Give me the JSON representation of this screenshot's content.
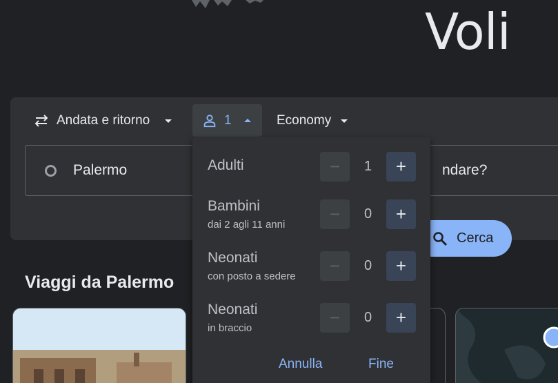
{
  "header": {
    "title": "Voli"
  },
  "search": {
    "trip_type": "Andata e ritorno",
    "passengers_count": "1",
    "cabin_class": "Economy",
    "origin": "Palermo",
    "destination_placeholder_visible": "ndare?",
    "search_label": "Cerca"
  },
  "passengers_panel": {
    "rows": [
      {
        "label": "Adulti",
        "sub": "",
        "value": "1"
      },
      {
        "label": "Bambini",
        "sub": "dai 2 agli 11 anni",
        "value": "0"
      },
      {
        "label": "Neonati",
        "sub": "con posto a sedere",
        "value": "0"
      },
      {
        "label": "Neonati",
        "sub": "in braccio",
        "value": "0"
      }
    ],
    "minus_symbol": "−",
    "plus_symbol": "+",
    "cancel_label": "Annulla",
    "done_label": "Fine"
  },
  "explore": {
    "title": "Viaggi da Palermo"
  },
  "colors": {
    "accent": "#8ab4f8",
    "background": "#202124",
    "surface": "#303134"
  }
}
